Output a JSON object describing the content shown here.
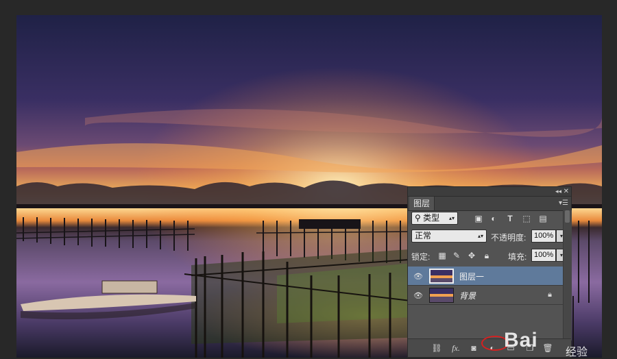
{
  "panel": {
    "tab_label": "图层",
    "filter": {
      "label": "类型"
    },
    "blend_mode": "正常",
    "opacity_label": "不透明度:",
    "opacity_value": "100%",
    "lock_label": "锁定:",
    "fill_label": "填充:",
    "fill_value": "100%",
    "layers": [
      {
        "name": "图层一",
        "selected": true,
        "visible": true,
        "locked": false
      },
      {
        "name": "背景",
        "selected": false,
        "visible": true,
        "locked": true
      }
    ],
    "bottom_icons": [
      "link-icon",
      "fx-icon",
      "mask-icon",
      "adjustment-icon",
      "group-icon",
      "new-layer-icon",
      "trash-icon"
    ],
    "fx_label": "fx."
  },
  "watermark": {
    "text": "Bai",
    "sub": "经验"
  },
  "colors": {
    "panel_bg": "#535353",
    "selected_layer": "#5f7a9b",
    "highlight_circle": "#d62020"
  }
}
